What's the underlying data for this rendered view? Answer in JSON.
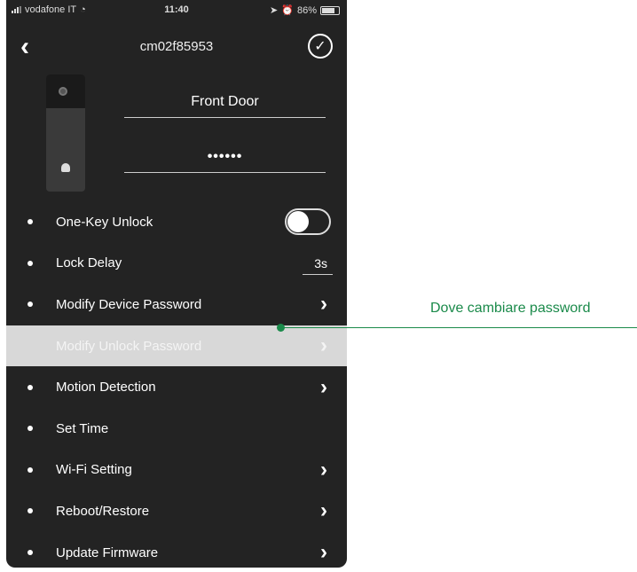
{
  "status_bar": {
    "carrier": "vodafone IT",
    "time": "11:40",
    "battery": "86%",
    "battery_level": 0.86
  },
  "nav": {
    "title": "cm02f85953"
  },
  "device": {
    "name": "Front Door",
    "password_mask": "••••••"
  },
  "menu": {
    "one_key_unlock": {
      "label": "One-Key Unlock",
      "on": false
    },
    "lock_delay": {
      "label": "Lock Delay",
      "value": "3s"
    },
    "modify_device_password": {
      "label": "Modify Device Password"
    },
    "modify_unlock_password": {
      "label": "Modify Unlock Password"
    },
    "motion_detection": {
      "label": "Motion Detection"
    },
    "set_time": {
      "label": "Set Time"
    },
    "wifi_setting": {
      "label": "Wi-Fi Setting"
    },
    "reboot_restore": {
      "label": "Reboot/Restore"
    },
    "update_firmware": {
      "label": "Update Firmware"
    }
  },
  "annotation": {
    "text": "Dove cambiare password",
    "color": "#1a8a4a"
  },
  "colors": {
    "background": "#232323",
    "highlight": "#d8d8d8"
  }
}
